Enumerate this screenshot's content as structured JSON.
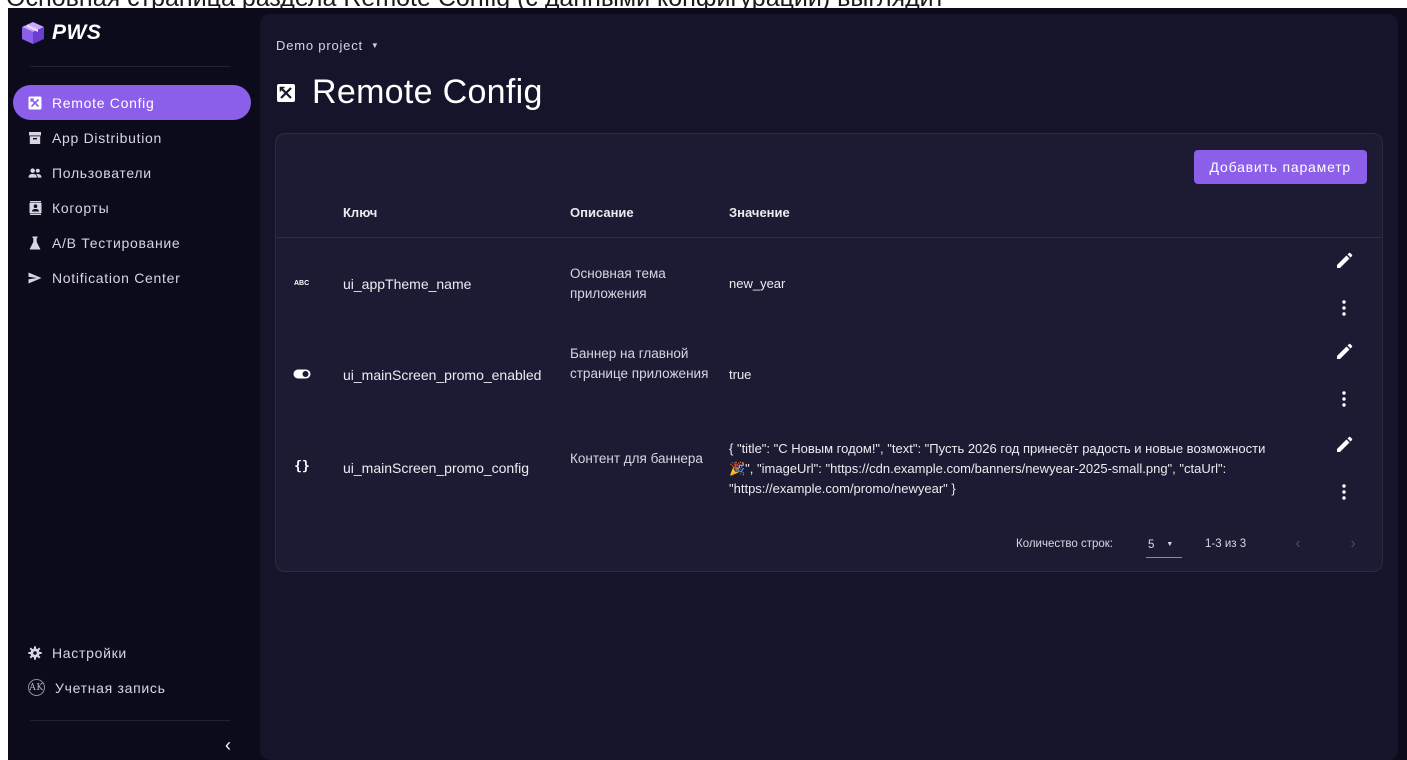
{
  "caption": "Основная страница раздела Remote Config (с данными конфигурации) выглядит",
  "app": {
    "logo_text": "PWS"
  },
  "colors": {
    "accent": "#8b5fe9",
    "background": "#0c0b1b",
    "card": "#1c1b33"
  },
  "sidebar": {
    "items": [
      {
        "label": "Remote Config",
        "icon": "remote-config-icon",
        "active": true
      },
      {
        "label": "App Distribution",
        "icon": "archive-icon"
      },
      {
        "label": "Пользователи",
        "icon": "users-icon"
      },
      {
        "label": "Когорты",
        "icon": "contacts-icon"
      },
      {
        "label": "A/B Тестирование",
        "icon": "flask-icon"
      },
      {
        "label": "Notification Center",
        "icon": "send-icon"
      }
    ],
    "bottom": [
      {
        "label": "Настройки",
        "icon": "gear-icon"
      },
      {
        "label": "Учетная запись",
        "icon": "avatar",
        "avatar_text": "AK"
      }
    ],
    "collapse": "‹"
  },
  "header": {
    "project": "Demo project",
    "title": "Remote Config"
  },
  "table": {
    "add_button": "Добавить параметр",
    "columns": {
      "key": "Ключ",
      "description": "Описание",
      "value": "Значение"
    },
    "rows": [
      {
        "type_icon": "text-type-icon",
        "key": "ui_appTheme_name",
        "description": "Основная тема приложения",
        "value": "new_year"
      },
      {
        "type_icon": "boolean-toggle-icon",
        "key": "ui_mainScreen_promo_enabled",
        "description": "Баннер на главной странице приложения",
        "value": "true"
      },
      {
        "type_icon": "json-braces-icon",
        "key": "ui_mainScreen_promo_config",
        "description": "Контент для баннера",
        "value": "{ \"title\": \"С Новым годом!\", \"text\": \"Пусть 2026 год принесёт радость и новые возможности 🎉\", \"imageUrl\": \"https://cdn.example.com/banners/newyear-2025-small.png\", \"ctaUrl\": \"https://example.com/promo/newyear\" }"
      }
    ],
    "pagination": {
      "rows_label": "Количество строк:",
      "rows_per_page": "5",
      "range": "1-3 из 3"
    }
  }
}
